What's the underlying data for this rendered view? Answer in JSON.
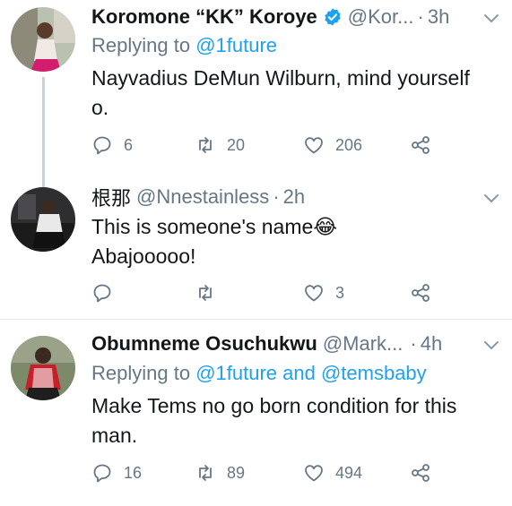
{
  "tweets": [
    {
      "name": "Koromone “KK” Koroye",
      "handle": "@Kor...",
      "time": "3h",
      "reply_prefix": "Replying to",
      "reply_to": "@1future",
      "text_line1": "Nayvadius DeMun Wilburn, mind yourself",
      "text_line2": "o.",
      "replies": "6",
      "retweets": "20",
      "likes": "206"
    },
    {
      "name": "根那",
      "handle": "@Nnestainless",
      "time": "2h",
      "text_line1": "This is someone's name😂",
      "text_line2": "Abajooooo!",
      "replies": "",
      "retweets": "",
      "likes": "3"
    },
    {
      "name": "Obumneme Osuchukwu",
      "handle": "@Mark...",
      "time": "4h",
      "reply_prefix": "Replying to",
      "reply_to": "@1future and @temsbaby",
      "text_line1": "Make Tems no go born condition for this",
      "text_line2": "man.",
      "replies": "16",
      "retweets": "89",
      "likes": "494"
    }
  ],
  "colors": {
    "text": "#14171a",
    "muted": "#657786",
    "link": "#1da1f2",
    "verified": "#1da1f2",
    "divider": "#e1e8ed"
  },
  "icons": [
    "verified-badge-icon",
    "chevron-down-icon",
    "reply-icon",
    "retweet-icon",
    "like-icon",
    "share-icon"
  ]
}
